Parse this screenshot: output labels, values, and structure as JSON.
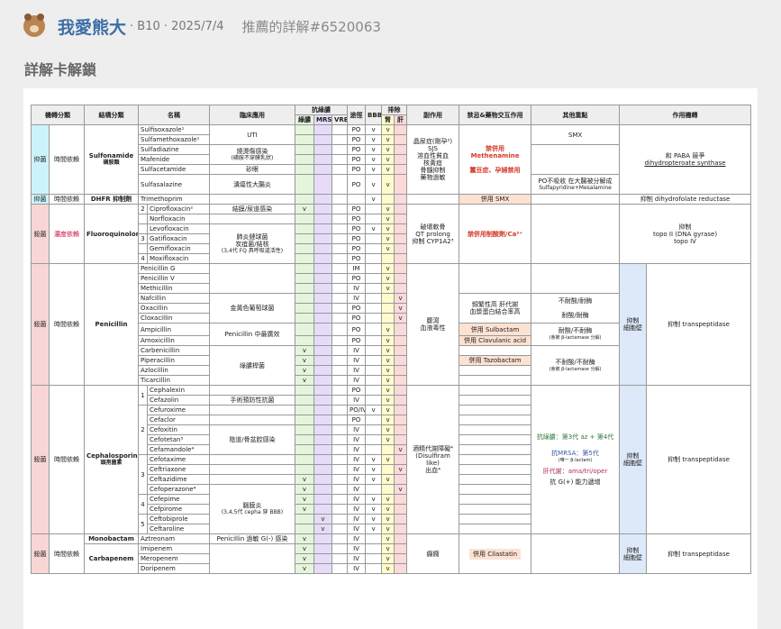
{
  "header": {
    "username": "我愛熊大",
    "meta": " · B10 · 2025/7/4",
    "title": "推薦的詳解#6520063"
  },
  "section_title": "詳解卡解鎖",
  "table": {
    "headers": {
      "mechanism": "機轉分類",
      "structure": "結構分類",
      "name": "名稱",
      "clinical": "臨床應用",
      "antipseudo": "抗綠膿",
      "green": "綠膿",
      "mrsa": "MRSA",
      "vre": "VRE",
      "route": "途徑",
      "bbb": "BBB",
      "excretion": "排除",
      "kidney": "腎",
      "liver": "肝",
      "side_effects": "副作用",
      "contra": "禁忌&藥物交互作用",
      "other": "其他重點",
      "moa": "作用機轉"
    },
    "sulfa": {
      "mech": "抑菌",
      "dep": "時間依賴",
      "class": "Sulfonamide",
      "class_sub": "磺胺類",
      "drugs": [
        {
          "name": "Sulfisoxazole¹",
          "route": "PO",
          "bbb": "v",
          "kid": "v"
        },
        {
          "name": "Sulfamethoxazole¹",
          "route": "PO",
          "bbb": "v",
          "kid": "v"
        },
        {
          "name": "Sulfadiazine",
          "route": "PO",
          "bbb": "v",
          "kid": "v"
        },
        {
          "name": "Mafenide",
          "route": "PO",
          "bbb": "v",
          "kid": "v"
        },
        {
          "name": "Sulfacetamide",
          "route": "PO",
          "bbb": "v",
          "kid": "v"
        },
        {
          "name": "Sulfasalazine",
          "route": "PO",
          "bbb": "v",
          "kid": "v"
        }
      ],
      "clin": [
        "UTI",
        "燒燙傷感染",
        "(磺胺不穿膜乳狀)",
        "砂眼",
        "潰瘍性大腸炎"
      ],
      "side": [
        "晶尿症(剛孕²)",
        "SJS",
        "溶血性貧血",
        "核黃疸",
        "骨髓抑制",
        "藥物過敏"
      ],
      "contra1": "禁併用 Methenamine",
      "contra2": "蠶豆症、孕婦禁用",
      "other1": "SMX",
      "other2": "PO不吸收 在大腸被分解成",
      "other3": "Sulfapyridine+Mesalamine",
      "moa1": "和 PABA 競爭",
      "moa2": "dihydropteroate synthase"
    },
    "dhfr": {
      "mech": "抑菌",
      "dep": "時間依賴",
      "class": "DHFR 抑制劑",
      "name": "Trimethoprim",
      "bbb": "v",
      "contra": "併用 SMX",
      "moa": "抑制 dihydrofolate reductase"
    },
    "fq": {
      "mech": "殺菌",
      "dep": "濃度依賴",
      "class": "Fluoroquinolone",
      "drugs": [
        {
          "gen": "2",
          "name": "Ciprofloxacin²",
          "green": "v",
          "route": "PO",
          "bbb": "",
          "kid": "v"
        },
        {
          "gen": "",
          "name": "Norfloxacin",
          "green": "",
          "route": "PO",
          "bbb": "",
          "kid": "v"
        },
        {
          "gen": "",
          "name": "Levofloxacin",
          "green": "",
          "route": "PO",
          "bbb": "v",
          "kid": "v"
        },
        {
          "gen": "3",
          "name": "Gatifloxacin",
          "green": "",
          "route": "PO",
          "bbb": "",
          "kid": "v"
        },
        {
          "gen": "",
          "name": "Gemifloxacin",
          "green": "",
          "route": "PO",
          "bbb": "",
          "kid": "v"
        },
        {
          "gen": "4",
          "name": "Moxifloxacin",
          "green": "",
          "route": "PO",
          "bbb": "",
          "kid": ""
        }
      ],
      "clin1": "結膜/尿道感染",
      "clin2": "肺炎鏈球菌",
      "clin3": "炭疽菌/結核",
      "clin4": "(3,4代 FQ 具呼吸道活性)",
      "side1": "破壞軟骨",
      "side2": "QT prolong",
      "side3": "抑制 CYP1A2³",
      "contra": "禁併用制酸劑/Ca²⁺",
      "moa1": "抑制",
      "moa2": "topo II (DNA gyrase)",
      "moa3": "topo IV"
    },
    "pen": {
      "mech": "殺菌",
      "dep": "時間依賴",
      "class": "Penicillin",
      "drugs": [
        {
          "name": "Penicillin G",
          "green": "",
          "route": "IM"
        },
        {
          "name": "Penicillin V",
          "green": "",
          "route": "PO"
        },
        {
          "name": "Methicillin",
          "green": "",
          "route": "IV"
        },
        {
          "name": "Nafcillin",
          "green": "",
          "route": "IV"
        },
        {
          "name": "Oxacillin",
          "green": "",
          "route": "PO"
        },
        {
          "name": "Cloxacillin",
          "green": "",
          "route": "PO"
        },
        {
          "name": "Ampicillin",
          "green": "",
          "route": "PO"
        },
        {
          "name": "Amoxicillin",
          "green": "",
          "route": "PO"
        },
        {
          "name": "Carbenicillin",
          "green": "v",
          "route": "IV"
        },
        {
          "name": "Piperacillin",
          "green": "v",
          "route": "IV"
        },
        {
          "name": "Azlocillin",
          "green": "v",
          "route": "IV"
        },
        {
          "name": "Ticarcillin",
          "green": "v",
          "route": "IV"
        }
      ],
      "clin1": "金黃色葡萄球菌",
      "clin2": "Penicillin 中最廣效",
      "clin3": "綠膿桿菌",
      "side1": "腹瀉",
      "side2": "血液毒性",
      "contra1": "頻繁性高 肝代謝",
      "contra2": "血漿蛋白結合率高",
      "contra3": "併用 Sulbactam",
      "contra4": "併用 Clavulanic acid",
      "contra5": "併用 Tazobactam",
      "other1": "不耐酸/耐酶",
      "other2": "耐酸/耐酶",
      "other3": "耐酸/不耐酶",
      "other4": "(會被 β-lactamase 分解)",
      "other5": "不耐酸/不耐酶",
      "other6": "(會被 β-lactamase 分解)",
      "moa1": "抑制",
      "moa2": "細胞壁",
      "moa3": "抑制 transpeptidase"
    },
    "ceph": {
      "mech": "殺菌",
      "dep": "時間依賴",
      "class": "Cephalosporin",
      "class_sub": "頭孢菌素",
      "drugs": [
        {
          "gen": "1",
          "name": "Cephalexin",
          "green": "",
          "mrsa": "",
          "route": "PO",
          "bbb": ""
        },
        {
          "gen": "",
          "name": "Cefazolin",
          "green": "",
          "mrsa": "",
          "route": "IV",
          "bbb": ""
        },
        {
          "gen": "",
          "name": "Cefuroxime",
          "green": "",
          "mrsa": "",
          "route": "PO/IV",
          "bbb": "v"
        },
        {
          "gen": "",
          "name": "Cefaclor",
          "green": "",
          "mrsa": "",
          "route": "PO",
          "bbb": ""
        },
        {
          "gen": "2",
          "name": "Cefoxitin",
          "green": "",
          "mrsa": "",
          "route": "IV",
          "bbb": ""
        },
        {
          "gen": "",
          "name": "Cefotetan⁵",
          "green": "",
          "mrsa": "",
          "route": "IV",
          "bbb": ""
        },
        {
          "gen": "",
          "name": "Cefamandole⁴",
          "green": "",
          "mrsa": "",
          "route": "IV",
          "bbb": ""
        },
        {
          "gen": "",
          "name": "Cefotaxime",
          "green": "",
          "mrsa": "",
          "route": "IV",
          "bbb": "v"
        },
        {
          "gen": "3",
          "name": "Ceftriaxone",
          "green": "",
          "mrsa": "",
          "route": "IV",
          "bbb": "v"
        },
        {
          "gen": "",
          "name": "Ceftazidime",
          "green": "v",
          "mrsa": "",
          "route": "IV",
          "bbb": "v"
        },
        {
          "gen": "",
          "name": "Cefoperazone⁴",
          "green": "v",
          "mrsa": "",
          "route": "IV",
          "bbb": ""
        },
        {
          "gen": "4",
          "name": "Cefepime",
          "green": "v",
          "mrsa": "",
          "route": "IV",
          "bbb": "v"
        },
        {
          "gen": "",
          "name": "Cefpirome",
          "green": "v",
          "mrsa": "",
          "route": "IV",
          "bbb": "v"
        },
        {
          "gen": "5",
          "name": "Ceftobiprole",
          "green": "",
          "mrsa": "v",
          "route": "IV",
          "bbb": "v"
        },
        {
          "gen": "",
          "name": "Ceftaroline",
          "green": "",
          "mrsa": "v",
          "route": "IV",
          "bbb": "v"
        }
      ],
      "clin1": "手術預防性抗菌",
      "clin2": "陰道/骨盆腔感染",
      "clin3": "腦膜炎",
      "clin4": "(3,4,5代 cepha 穿 BBB)",
      "side1": "酒精代謝障礙⁴",
      "side2": "(Disulfiram like)",
      "side3": "出血⁴",
      "other1": "抗綠膿：第3代 az + 第4代",
      "other2": "抗MRSA：第5代",
      "other3": "(唯一 β-lactam)",
      "other4": "肝代謝：ama/tri/oper",
      "other5": "抗 G(+) 能力遞增",
      "moa1": "抑制",
      "moa2": "細胞壁",
      "moa3": "抑制 transpeptidase"
    },
    "mono": {
      "class": "Monobactam",
      "name": "Aztreonam",
      "clin": "Penicillin 過敏 G(-) 感染",
      "green": "v",
      "route": "IV"
    },
    "carba": {
      "mech": "殺菌",
      "dep": "時間依賴",
      "class": "Carbapenem",
      "drugs": [
        {
          "name": "Imipenem",
          "green": "v",
          "route": "IV"
        },
        {
          "name": "Meropenem",
          "green": "v",
          "route": "IV"
        },
        {
          "name": "Doripenem",
          "green": "v",
          "route": "IV"
        }
      ],
      "side": "癲癇",
      "contra": "併用 Cilastatin",
      "moa1": "抑制",
      "moa2": "細胞壁",
      "moa3": "抑制 transpeptidase"
    }
  }
}
